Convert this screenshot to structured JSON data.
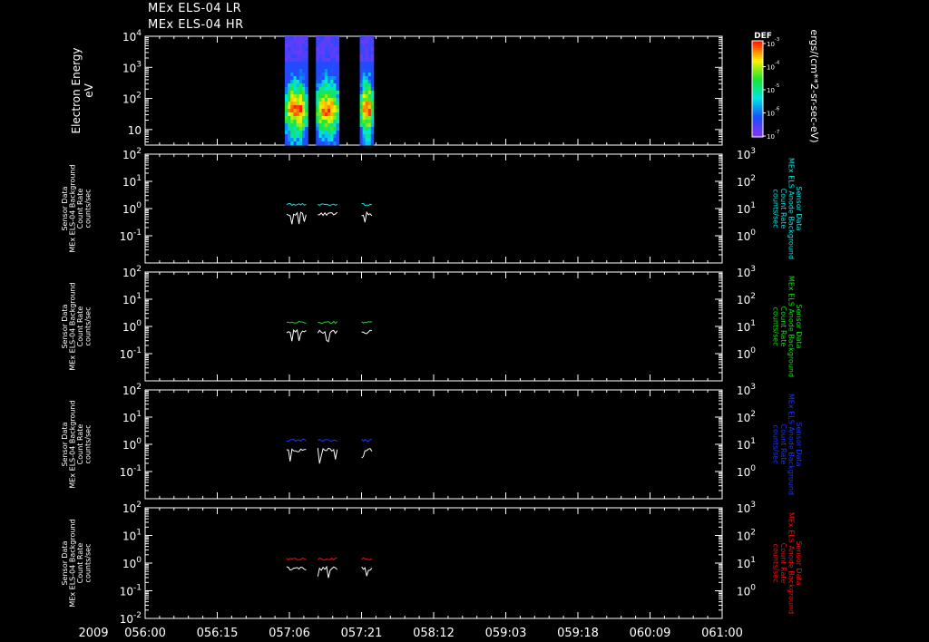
{
  "titles": [
    "MEx ELS-04 LR",
    "MEx ELS-04 HR"
  ],
  "colors": {
    "background": "#000000",
    "axes": "#ffffff",
    "white_trace": "#ffffff",
    "cyan": "#00e5e5",
    "green": "#11dd11",
    "blue": "#1f33ff",
    "red": "#ee1111"
  },
  "x_axis": {
    "year_label": "2009",
    "tick_labels": [
      "056:00",
      "056:15",
      "057:06",
      "057:21",
      "058:12",
      "059:03",
      "059:18",
      "060:09",
      "061:00"
    ]
  },
  "chart_data": [
    {
      "type": "heatmap",
      "id": "spectrogram",
      "ylabel": [
        "Electron Energy",
        "eV"
      ],
      "y_scale": "log",
      "ylim_log10": [
        0.5,
        4
      ],
      "y_tick_labels": [
        {
          "log": 1,
          "label": "10",
          "exp": ""
        },
        {
          "log": 2,
          "label": "10",
          "exp": "2"
        },
        {
          "log": 3,
          "label": "10",
          "exp": "3"
        },
        {
          "log": 4,
          "label": "10",
          "exp": "4"
        }
      ],
      "colorbar": {
        "title": "DEF",
        "label": "ergs/(cm**2-sr-sec-eV)",
        "ticks": [
          {
            "label": "10",
            "exp": "-3"
          },
          {
            "label": "10",
            "exp": "-4"
          },
          {
            "label": "10",
            "exp": "-5"
          },
          {
            "label": "10",
            "exp": "-6"
          },
          {
            "label": "10",
            "exp": "-7"
          }
        ]
      },
      "bursts_x_frac": [
        [
          0.242,
          0.282
        ],
        [
          0.296,
          0.336
        ],
        [
          0.372,
          0.396
        ]
      ]
    },
    {
      "type": "line",
      "id": "panel1",
      "series_color": "cyan",
      "left_label": [
        "Sensor Data",
        "MEx ELS-04 Background",
        "Count Rate",
        "counts/sec"
      ],
      "right_label": [
        "Sensor Data",
        "MEx ELS Anode Background",
        "Count Rate",
        "counts/sec"
      ],
      "left_ylim_log10": [
        -2,
        2
      ],
      "right_ylim_log10": [
        -1,
        3
      ],
      "left_ticks": [
        {
          "label": "10",
          "exp": "2"
        },
        {
          "label": "10",
          "exp": "1"
        },
        {
          "label": "10",
          "exp": "0"
        },
        {
          "label": "10",
          "exp": "-1"
        }
      ],
      "right_ticks": [
        {
          "label": "10",
          "exp": "3"
        },
        {
          "label": "10",
          "exp": "2"
        },
        {
          "label": "10",
          "exp": "1"
        },
        {
          "label": "10",
          "exp": "0"
        }
      ],
      "colored_level_log10": 0.15,
      "white_level_log10": -0.2
    },
    {
      "type": "line",
      "id": "panel2",
      "series_color": "green",
      "left_label": [
        "Sensor Data",
        "MEx ELS-04 Background",
        "Count Rate",
        "counts/sec"
      ],
      "right_label": [
        "Sensor Data",
        "MEx ELS Anode Background",
        "Count Rate",
        "counts/sec"
      ],
      "left_ylim_log10": [
        -2,
        2
      ],
      "right_ylim_log10": [
        -1,
        3
      ],
      "left_ticks": [
        {
          "label": "10",
          "exp": "2"
        },
        {
          "label": "10",
          "exp": "1"
        },
        {
          "label": "10",
          "exp": "0"
        },
        {
          "label": "10",
          "exp": "-1"
        }
      ],
      "right_ticks": [
        {
          "label": "10",
          "exp": "3"
        },
        {
          "label": "10",
          "exp": "2"
        },
        {
          "label": "10",
          "exp": "1"
        },
        {
          "label": "10",
          "exp": "0"
        }
      ],
      "colored_level_log10": 0.15,
      "white_level_log10": -0.2
    },
    {
      "type": "line",
      "id": "panel3",
      "series_color": "blue",
      "left_label": [
        "Sensor Data",
        "MEx ELS-04 Background",
        "Count Rate",
        "counts/sec"
      ],
      "right_label": [
        "Sensor Data",
        "MEx ELS Anode Background",
        "Count Rate",
        "counts/sec"
      ],
      "left_ylim_log10": [
        -2,
        2
      ],
      "right_ylim_log10": [
        -1,
        3
      ],
      "left_ticks": [
        {
          "label": "10",
          "exp": "2"
        },
        {
          "label": "10",
          "exp": "1"
        },
        {
          "label": "10",
          "exp": "0"
        },
        {
          "label": "10",
          "exp": "-1"
        }
      ],
      "right_ticks": [
        {
          "label": "10",
          "exp": "3"
        },
        {
          "label": "10",
          "exp": "2"
        },
        {
          "label": "10",
          "exp": "1"
        },
        {
          "label": "10",
          "exp": "0"
        }
      ],
      "colored_level_log10": 0.15,
      "white_level_log10": -0.2
    },
    {
      "type": "line",
      "id": "panel4",
      "series_color": "red",
      "left_label": [
        "Sensor Data",
        "MEx ELS-04 Background",
        "Count Rate",
        "counts/sec"
      ],
      "right_label": [
        "Sensor Data",
        "MEx ELS Anode Background",
        "Count Rate",
        "counts/sec"
      ],
      "left_ylim_log10": [
        -2,
        2
      ],
      "right_ylim_log10": [
        -1,
        3
      ],
      "left_ticks": [
        {
          "label": "10",
          "exp": "2"
        },
        {
          "label": "10",
          "exp": "1"
        },
        {
          "label": "10",
          "exp": "0"
        },
        {
          "label": "10",
          "exp": "-1"
        },
        {
          "label": "10",
          "exp": "-2"
        }
      ],
      "right_ticks": [
        {
          "label": "10",
          "exp": "3"
        },
        {
          "label": "10",
          "exp": "2"
        },
        {
          "label": "10",
          "exp": "1"
        },
        {
          "label": "10",
          "exp": "0"
        }
      ],
      "colored_level_log10": 0.15,
      "white_level_log10": -0.2
    }
  ]
}
